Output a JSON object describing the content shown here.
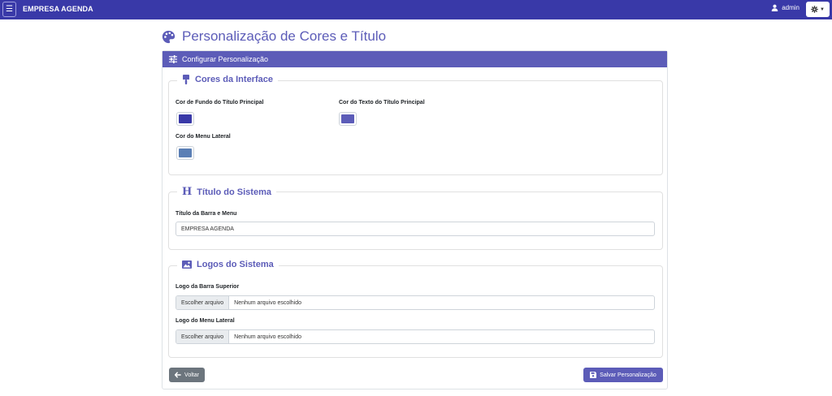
{
  "navbar": {
    "brand": "EMPRESA AGENDA",
    "user": "admin"
  },
  "page": {
    "title": "Personalização de Cores e Título"
  },
  "card": {
    "header": "Configurar Personalização"
  },
  "colors_section": {
    "legend": "Cores da Interface",
    "title_bg_label": "Cor de Fundo do Título Principal",
    "title_bg_color": "#3939a8",
    "title_text_label": "Cor do Texto do Título Principal",
    "title_text_color": "#5c5cb8",
    "menu_label": "Cor do Menu Lateral",
    "menu_color": "#5b7fb5"
  },
  "title_section": {
    "legend": "Título do Sistema",
    "field_label": "Título da Barra e Menu",
    "field_value": "EMPRESA AGENDA"
  },
  "logos_section": {
    "legend": "Logos do Sistema",
    "top_logo_label": "Logo da Barra Superior",
    "side_logo_label": "Logo do Menu Lateral",
    "choose_file": "Escolher arquivo",
    "no_file": "Nenhum arquivo escolhido"
  },
  "actions": {
    "back": "Voltar",
    "save": "Salvar Personalização"
  },
  "theme": {
    "navbar_bg": "#3939a8",
    "accent": "#5c5cb8",
    "secondary": "#6c757d"
  }
}
